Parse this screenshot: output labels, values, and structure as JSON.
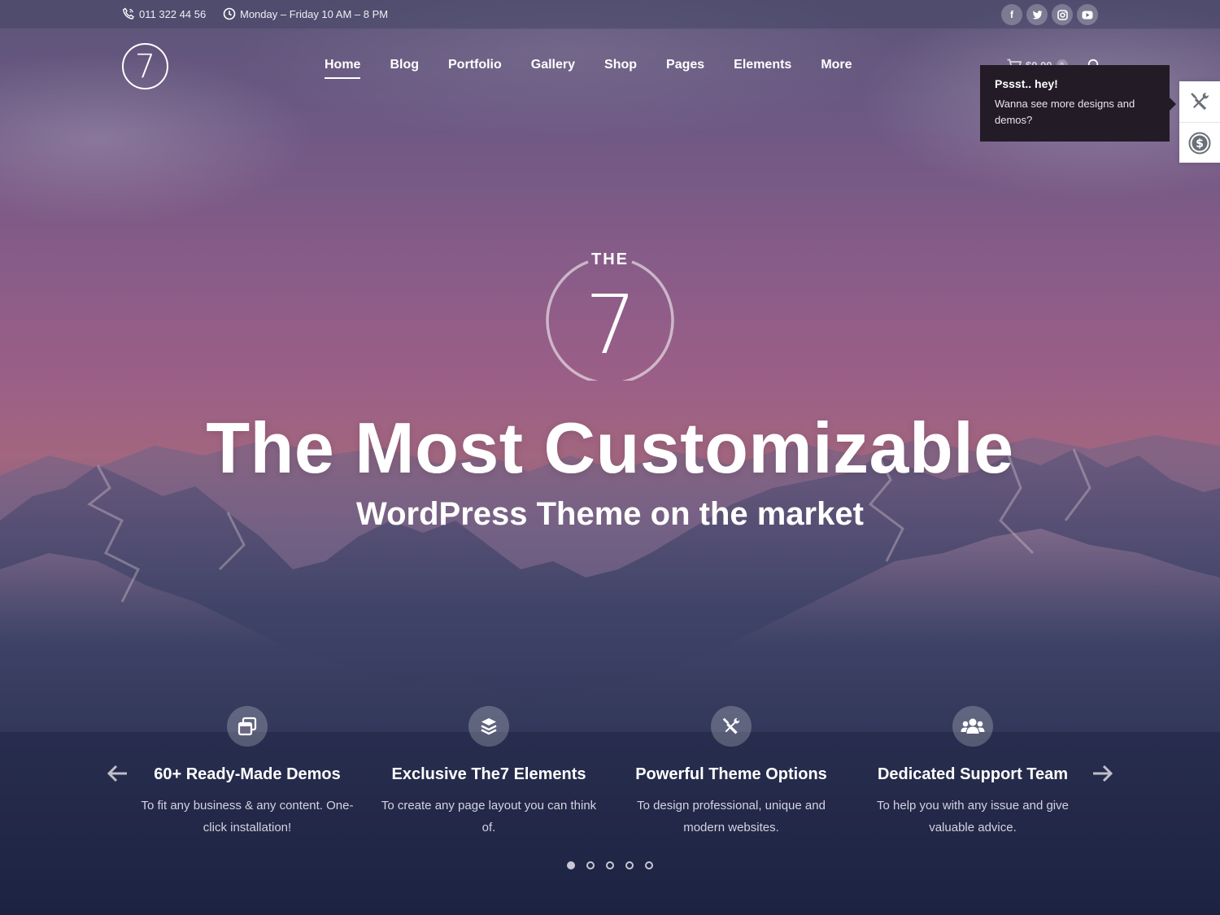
{
  "topbar": {
    "phone": "011 322 44 56",
    "hours": "Monday – Friday 10 AM – 8 PM",
    "social": [
      {
        "icon": "facebook-icon",
        "glyph": "f"
      },
      {
        "icon": "twitter-icon",
        "glyph": "t"
      },
      {
        "icon": "instagram-icon",
        "glyph": "◎"
      },
      {
        "icon": "youtube-icon",
        "glyph": "▶"
      }
    ]
  },
  "header": {
    "logo_text": "7",
    "nav": [
      {
        "label": "Home",
        "active": true
      },
      {
        "label": "Blog",
        "active": false
      },
      {
        "label": "Portfolio",
        "active": false
      },
      {
        "label": "Gallery",
        "active": false
      },
      {
        "label": "Shop",
        "active": false
      },
      {
        "label": "Pages",
        "active": false
      },
      {
        "label": "Elements",
        "active": false
      },
      {
        "label": "More",
        "active": false
      }
    ],
    "cart_total": "$0.00",
    "cart_count": "0"
  },
  "popup": {
    "title": "Pssst.. hey!",
    "text": "Wanna see more designs and demos?"
  },
  "side_panel": {
    "buttons": [
      "tools-icon",
      "dollar-icon"
    ]
  },
  "hero": {
    "logo_small": "THE",
    "logo_number": "7",
    "title": "The Most Customizable",
    "subtitle": "WordPress Theme on the market"
  },
  "features": [
    {
      "icon": "windows-icon",
      "title": "60+ Ready-Made Demos",
      "desc": "To fit any business & any content. One-click installation!"
    },
    {
      "icon": "layers-icon",
      "title": "Exclusive The7 Elements",
      "desc": "To create any page layout you can think of."
    },
    {
      "icon": "tools-icon",
      "title": "Powerful Theme Options",
      "desc": "To design professional, unique and modern websites."
    },
    {
      "icon": "users-icon",
      "title": "Dedicated Support Team",
      "desc": "To help you with any issue and give valuable advice."
    }
  ],
  "slider": {
    "total_dots": 5,
    "active_dot": 1
  },
  "colors": {
    "topbar": "#464664",
    "popup_bg": "#231c26",
    "text": "#ffffff"
  }
}
